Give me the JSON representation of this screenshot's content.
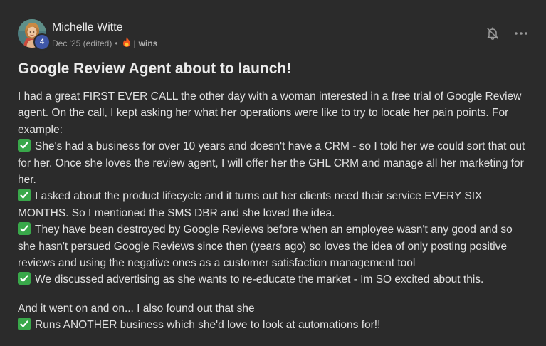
{
  "post": {
    "author": {
      "name": "Michelle Witte",
      "level": "4"
    },
    "meta": {
      "date": "Dec '25 (edited)",
      "dot": "•",
      "separator": "|",
      "category": "wins"
    },
    "title": "Google Review Agent about to launch!",
    "paragraphs": {
      "p1": "I had a great FIRST EVER CALL the other day with a woman interested in a free trial of Google Review agent. On the call, I kept asking her what her operations were like to try to locate her pain points. For example:",
      "b1": "She's had a business for over 10 years and doesn't have a CRM - so I told her we could sort that out for her. Once she loves the review agent, I will offer her the GHL CRM and manage all her marketing for her.",
      "b2": "I asked about the product lifecycle and it turns out her clients need their service EVERY SIX MONTHS. So I mentioned the SMS DBR and she loved the idea.",
      "b3": "They have been destroyed by Google Reviews before when an employee wasn't any good and so she hasn't persued Google Reviews since then (years ago) so loves the idea of only posting positive reviews and using the negative ones as a customer satisfaction management tool",
      "b4": "We discussed advertising as she wants to re-educate the market - Im SO excited about this.",
      "p2": "And it went on and on... I also found out that she",
      "b5": "Runs ANOTHER business which she'd love to look at automations for!!"
    }
  },
  "icons": {
    "bell": "bell-off-icon",
    "more": "more-horizontal-icon",
    "fire": "fire-icon",
    "check": "check-mark-button-icon"
  },
  "colors": {
    "background": "#2b2b2b",
    "text": "#e0e0e0",
    "muted": "#a3a3a3",
    "badge": "#3f57a8",
    "check": "#39a84a"
  }
}
